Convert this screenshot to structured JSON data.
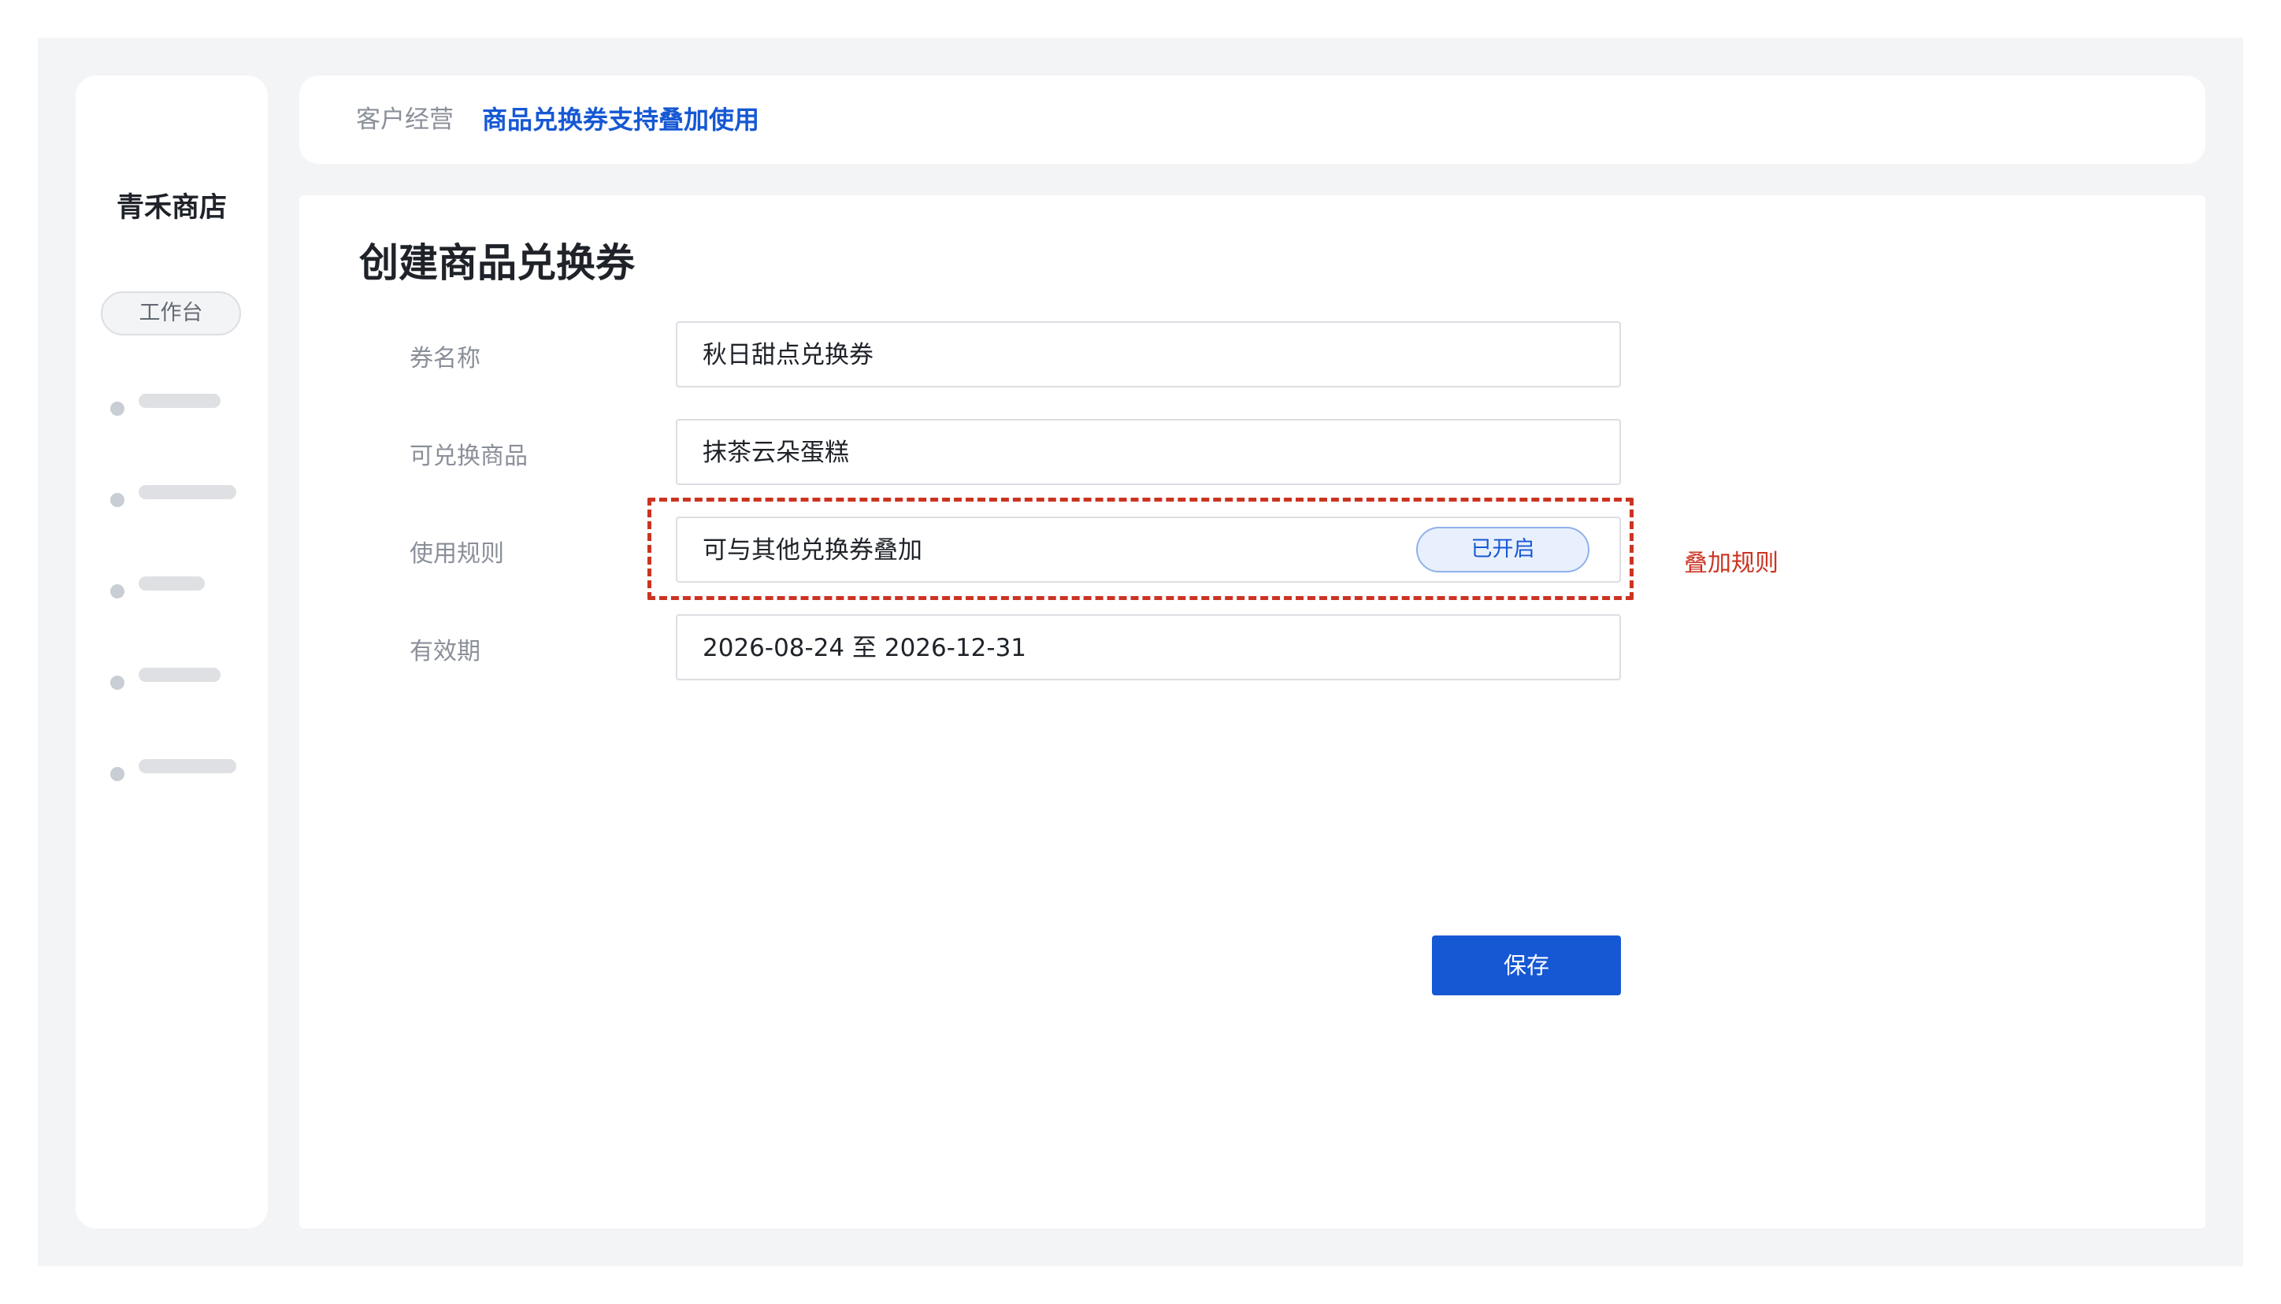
{
  "sidebar": {
    "brand": "青禾商店",
    "workbench_label": "工作台"
  },
  "header": {
    "breadcrumb_parent": "客户经营",
    "breadcrumb_current": "商品兑换券支持叠加使用"
  },
  "form": {
    "title": "创建商品兑换券",
    "fields": [
      {
        "label": "券名称",
        "value": "秋日甜点兑换券"
      },
      {
        "label": "可兑换商品",
        "value": "抹茶云朵蛋糕"
      },
      {
        "label": "使用规则",
        "value": "可与其他兑换券叠加",
        "toggle": "已开启"
      },
      {
        "label": "有效期",
        "value": "2026-08-24 至 2026-12-31"
      }
    ],
    "save_label": "保存"
  },
  "annotation": {
    "label": "叠加规则"
  },
  "colors": {
    "accent": "#1658d4",
    "annotation": "#cc3322",
    "background": "#f3f4f6"
  }
}
